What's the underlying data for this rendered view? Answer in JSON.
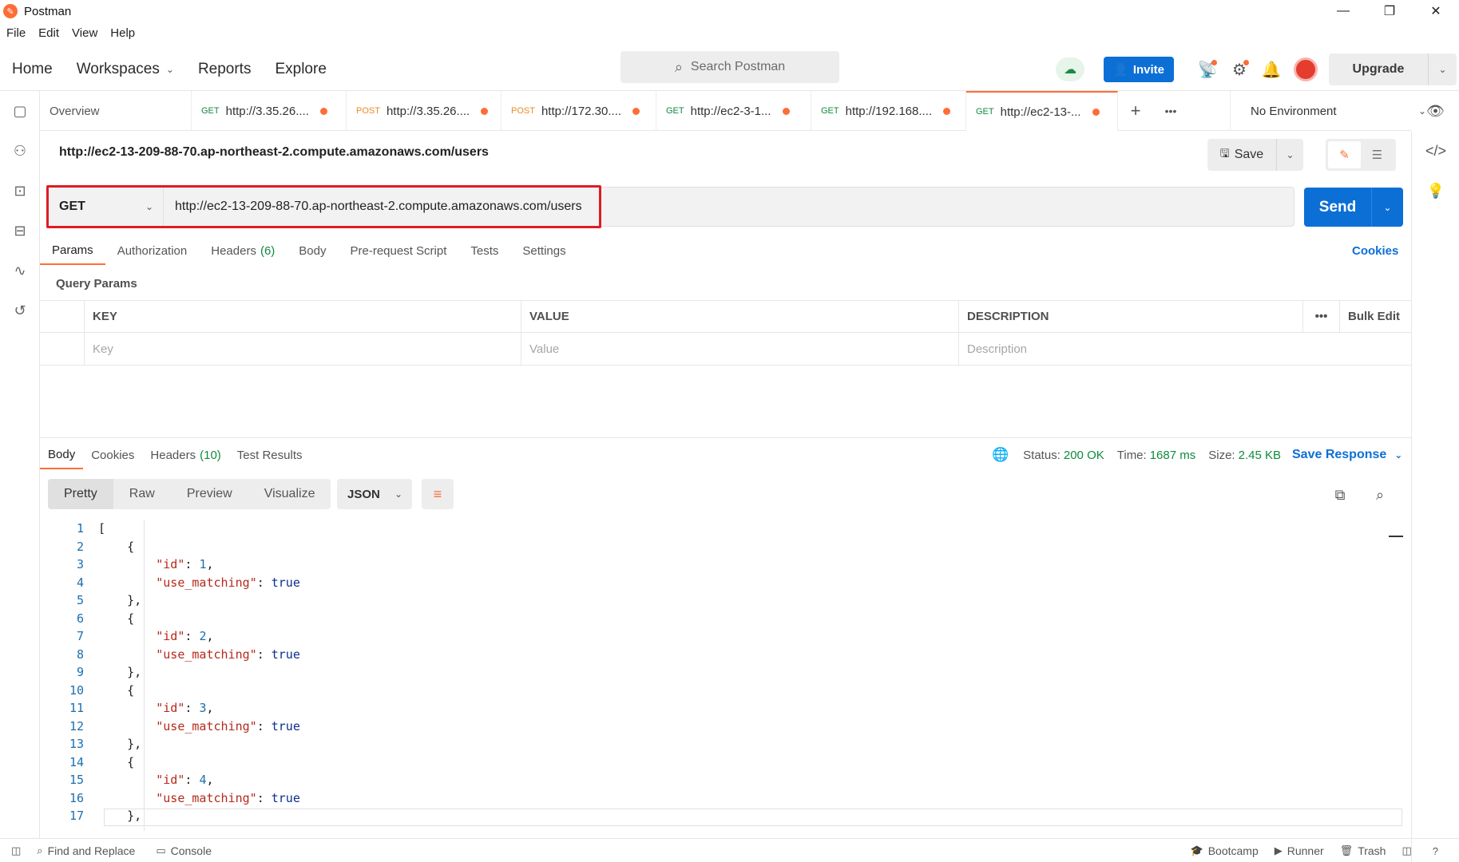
{
  "window": {
    "title": "Postman",
    "controls": [
      "minimize",
      "restore",
      "close"
    ]
  },
  "menu": [
    "File",
    "Edit",
    "View",
    "Help"
  ],
  "header": {
    "nav": {
      "home": "Home",
      "workspaces": "Workspaces",
      "reports": "Reports",
      "explore": "Explore"
    },
    "search_placeholder": "Search Postman",
    "invite_label": "Invite",
    "upgrade_label": "Upgrade"
  },
  "tabs": {
    "overview": "Overview",
    "items": [
      {
        "method": "GET",
        "url": "http://3.35.26...."
      },
      {
        "method": "POST",
        "url": "http://3.35.26...."
      },
      {
        "method": "POST",
        "url": "http://172.30...."
      },
      {
        "method": "GET",
        "url": "http://ec2-3-1..."
      },
      {
        "method": "GET",
        "url": "http://192.168...."
      },
      {
        "method": "GET",
        "url": "http://ec2-13-..."
      }
    ],
    "environment": "No Environment"
  },
  "request": {
    "title": "http://ec2-13-209-88-70.ap-northeast-2.compute.amazonaws.com/users",
    "save_label": "Save",
    "method": "GET",
    "url": "http://ec2-13-209-88-70.ap-northeast-2.compute.amazonaws.com/users",
    "send_label": "Send",
    "subtabs": {
      "params": "Params",
      "authorization": "Authorization",
      "headers": "Headers",
      "headers_count": "(6)",
      "body": "Body",
      "prerequest": "Pre-request Script",
      "tests": "Tests",
      "settings": "Settings"
    },
    "cookies_label": "Cookies",
    "query_params_label": "Query Params",
    "params_table": {
      "columns": [
        "KEY",
        "VALUE",
        "DESCRIPTION"
      ],
      "bulk_edit": "Bulk Edit",
      "placeholders": {
        "key": "Key",
        "value": "Value",
        "description": "Description"
      }
    }
  },
  "response": {
    "tabs": {
      "body": "Body",
      "cookies": "Cookies",
      "headers": "Headers",
      "headers_count": "(10)",
      "test_results": "Test Results"
    },
    "status_label": "Status:",
    "status_value": "200 OK",
    "time_label": "Time:",
    "time_value": "1687 ms",
    "size_label": "Size:",
    "size_value": "2.45 KB",
    "save_response": "Save Response",
    "views": [
      "Pretty",
      "Raw",
      "Preview",
      "Visualize"
    ],
    "format": "JSON",
    "lines": [
      {
        "n": "1",
        "indent": 0,
        "text": "["
      },
      {
        "n": "2",
        "indent": 1,
        "text": "{"
      },
      {
        "n": "3",
        "indent": 2,
        "key": "\"id\"",
        "num": "1",
        "trail": ","
      },
      {
        "n": "4",
        "indent": 2,
        "key": "\"use_matching\"",
        "bool": "true"
      },
      {
        "n": "5",
        "indent": 1,
        "text": "},"
      },
      {
        "n": "6",
        "indent": 1,
        "text": "{"
      },
      {
        "n": "7",
        "indent": 2,
        "key": "\"id\"",
        "num": "2",
        "trail": ","
      },
      {
        "n": "8",
        "indent": 2,
        "key": "\"use_matching\"",
        "bool": "true"
      },
      {
        "n": "9",
        "indent": 1,
        "text": "},"
      },
      {
        "n": "10",
        "indent": 1,
        "text": "{"
      },
      {
        "n": "11",
        "indent": 2,
        "key": "\"id\"",
        "num": "3",
        "trail": ","
      },
      {
        "n": "12",
        "indent": 2,
        "key": "\"use_matching\"",
        "bool": "true"
      },
      {
        "n": "13",
        "indent": 1,
        "text": "},"
      },
      {
        "n": "14",
        "indent": 1,
        "text": "{"
      },
      {
        "n": "15",
        "indent": 2,
        "key": "\"id\"",
        "num": "4",
        "trail": ","
      },
      {
        "n": "16",
        "indent": 2,
        "key": "\"use_matching\"",
        "bool": "true"
      },
      {
        "n": "17",
        "indent": 1,
        "text": "},"
      }
    ]
  },
  "statusbar": {
    "find_replace": "Find and Replace",
    "console": "Console",
    "bootcamp": "Bootcamp",
    "runner": "Runner",
    "trash": "Trash"
  },
  "colors": {
    "accent": "#ff6c37",
    "primary_blue": "#0c6fd6",
    "success_green": "#0f8a3f",
    "highlight_red": "#e01b24"
  }
}
